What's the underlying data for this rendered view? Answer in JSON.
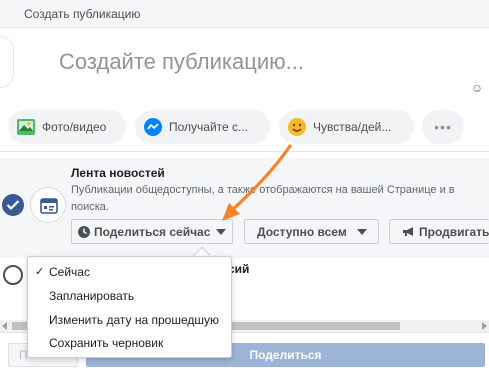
{
  "header": {
    "title": "Создать публикацию"
  },
  "composer": {
    "placeholder": "Создайте публикацию...",
    "emoji_icon": "smile-icon"
  },
  "chips": [
    {
      "label": "Фото/видео",
      "icon": "photo-icon"
    },
    {
      "label": "Получайте с...",
      "icon": "messenger-icon"
    },
    {
      "label": "Чувства/дей...",
      "icon": "emoji-icon"
    },
    {
      "label": "•••",
      "icon": "more-icon"
    }
  ],
  "news_feed": {
    "title": "Лента новостей",
    "description_line1": "Публикации общедоступны, а также отображаются на вашей Странице и в",
    "description_line2": "поиска.",
    "selected": true
  },
  "buttons": {
    "share_now": "Поделиться сейчас",
    "audience": "Доступно всем",
    "promote": "Продвигать"
  },
  "stories": {
    "title_partial": "сий",
    "selected": false
  },
  "dropdown": {
    "items": [
      {
        "label": "Сейчас",
        "checked": true,
        "check_mark": "✓"
      },
      {
        "label": "Запланировать",
        "checked": false
      },
      {
        "label": "Изменить дату на прошедшую",
        "checked": false
      },
      {
        "label": "Сохранить черновик",
        "checked": false
      }
    ]
  },
  "footer": {
    "preview_label": "П",
    "post_label": "Поделиться"
  },
  "colors": {
    "accent": "#385898",
    "post_button": "#9cb4d8",
    "annotation_arrow": "#f5832b",
    "messenger": "#0084ff",
    "photo": "#45bd62",
    "emoji": "#f7b928"
  }
}
